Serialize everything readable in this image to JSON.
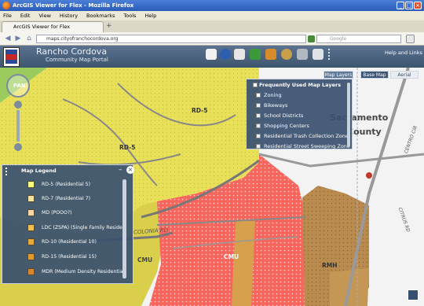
{
  "window": {
    "title": "ArcGIS Viewer for Flex - Mozilla Firefox",
    "minimize": "_",
    "maximize": "□",
    "close": "×"
  },
  "menu": [
    "File",
    "Edit",
    "View",
    "History",
    "Bookmarks",
    "Tools",
    "Help"
  ],
  "tab": {
    "label": "ArcGIS Viewer for Flex",
    "new_tab": "+"
  },
  "nav": {
    "back": "◀",
    "forward": "▶",
    "url": "maps.cityofranchocordova.org",
    "search_placeholder": "Google",
    "home": "⌂"
  },
  "app": {
    "title": "Rancho Cordova",
    "subtitle": "Community Map Portal",
    "help_link": "Help and Links"
  },
  "map_tabs": {
    "map_layers": "Map Layers",
    "base_map": "Base Map",
    "aerial": "Aerial"
  },
  "map_layers_panel": {
    "header": "Frequently Used Map Layers",
    "items": [
      {
        "label": "Zoning",
        "checked": true
      },
      {
        "label": "Bikeways",
        "checked": false
      },
      {
        "label": "School Districts",
        "checked": false
      },
      {
        "label": "Shopping Centers",
        "checked": false
      },
      {
        "label": "Residential Trash Collection Zone",
        "checked": false
      },
      {
        "label": "Residential Street Sweeping Zone",
        "checked": false
      }
    ]
  },
  "legend": {
    "title": "Map Legend",
    "items": [
      {
        "label": "RD-5 (Residential 5)",
        "color": "#ffff80"
      },
      {
        "label": "RD-7 (Residential 7)",
        "color": "#f6e19b"
      },
      {
        "label": "MD (POOO?)",
        "color": "#f8d6a6"
      },
      {
        "label": "LDC (ZSPA) (Single Family Reside",
        "color": "#efc050"
      },
      {
        "label": "RD-10 (Residential 10)",
        "color": "#e7a93b"
      },
      {
        "label": "RD-15 (Residential 15)",
        "color": "#e09a2e"
      },
      {
        "label": "MDR (Medium Density Residential",
        "color": "#d6872a"
      }
    ]
  },
  "map_labels": {
    "rd5_a": "RD-5",
    "rd5_b": "RD-5",
    "cmu_a": "CMU",
    "cmu_b": "CMU",
    "rmh": "RMH",
    "sacramento": "Sacramento",
    "county": "County",
    "colonia_rd": "COLONIA RD",
    "citrus_rd": "CITRUS RD",
    "cen_cir": "CENTRO CIR"
  },
  "nav_widget": {
    "pan": "PAN"
  },
  "colors": {
    "zoning_yellow": "#e9e05a",
    "commercial_red": "#f7665d",
    "rmh_brown": "#b98b4f",
    "panel_blue": "#385070"
  }
}
